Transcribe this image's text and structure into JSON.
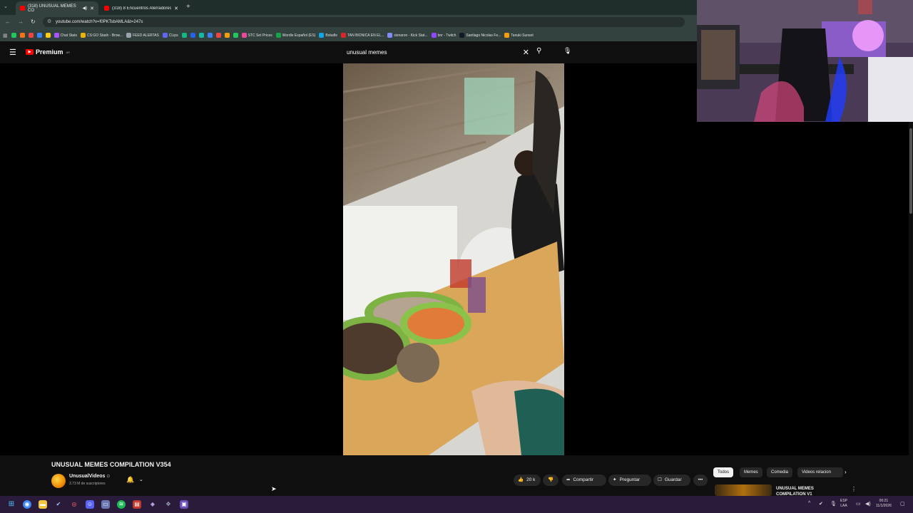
{
  "browser": {
    "tabs": [
      {
        "title": "(318) UNUSUAL MEMES CO",
        "active": true
      },
      {
        "title": "(318) 8 Encuentros Aterradores",
        "active": false
      }
    ],
    "url": "youtube.com/watch?v=f0PKTsbAMLA&t=247s",
    "bookmarks": [
      {
        "label": "",
        "color": "#22c55e"
      },
      {
        "label": "",
        "color": "#f97316"
      },
      {
        "label": "",
        "color": "#ef4444"
      },
      {
        "label": "",
        "color": "#3b82f6"
      },
      {
        "label": "",
        "color": "#facc15"
      },
      {
        "label": "Chat Stats",
        "color": "#a855f7"
      },
      {
        "label": "CS:GO Stash - Brow...",
        "color": "#eab308"
      },
      {
        "label": "FEED ALERTAS",
        "color": "#9ca3af"
      },
      {
        "label": "CLips",
        "color": "#6366f1"
      },
      {
        "label": "",
        "color": "#10b981"
      },
      {
        "label": "",
        "color": "#2563eb"
      },
      {
        "label": "",
        "color": "#14b8a6"
      },
      {
        "label": "",
        "color": "#3b82f6"
      },
      {
        "label": "",
        "color": "#ef4444"
      },
      {
        "label": "",
        "color": "#f59e0b"
      },
      {
        "label": "",
        "color": "#22c55e"
      },
      {
        "label": "STC Set Prices",
        "color": "#ec4899"
      },
      {
        "label": "Wordle Español (ES)",
        "color": "#16a34a"
      },
      {
        "label": "Boludle",
        "color": "#0ea5e9"
      },
      {
        "label": "TAN BIONICA EN EL...",
        "color": "#dc2626"
      },
      {
        "label": "sixnaron - Kick Stat...",
        "color": "#818cf8"
      },
      {
        "label": "bnr - Twitch",
        "color": "#9146ff"
      },
      {
        "label": "Santiago Nicolas Fe...",
        "color": "#111827"
      },
      {
        "label": "Tanuki Sunset",
        "color": "#f59e0b"
      }
    ]
  },
  "youtube": {
    "logo_text": "Premium",
    "region": "AR",
    "search_query": "unusual memes",
    "video_title": "UNUSUAL MEMES COMPILATION V354",
    "channel_name": "UnusualVideos",
    "verified_mark": "⊙",
    "subscribers": "3.73 M de suscriptores",
    "likes": "20 k",
    "actions": {
      "share": "Compartir",
      "ask": "Preguntar",
      "save": "Guardar"
    },
    "chips": [
      "Todos",
      "Memes",
      "Comedia",
      "Videos relacion"
    ],
    "recommended": {
      "title": "UNUSUAL MEMES COMPILATION V1"
    }
  },
  "taskbar": {
    "language": "ESP",
    "region": "LAA",
    "time": "00:21",
    "date": "11/1/2026"
  }
}
